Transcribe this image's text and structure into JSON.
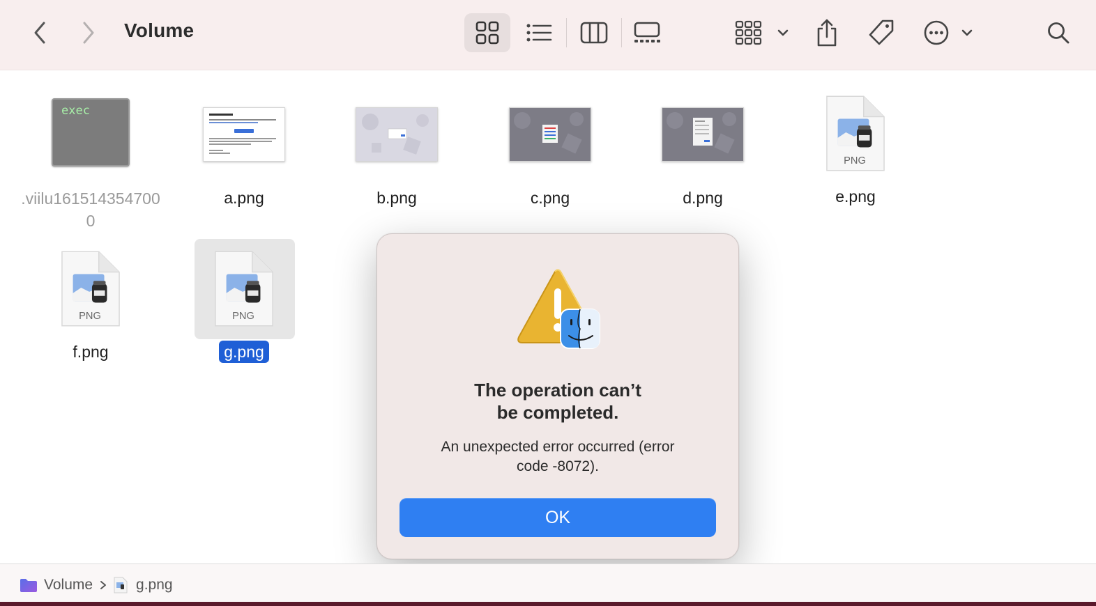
{
  "window": {
    "title": "Volume"
  },
  "toolbar": {
    "back": "back",
    "forward": "forward",
    "views": [
      "icon-view",
      "list-view",
      "column-view",
      "gallery-view"
    ],
    "group": "group-by",
    "share": "share",
    "tags": "tags",
    "more": "more-actions",
    "search": "search"
  },
  "files": [
    {
      "name": ".viilu1615143547000",
      "kind": "exec",
      "icon_text": "exec",
      "hidden": true
    },
    {
      "name": "a.png",
      "kind": "screenshot-doc"
    },
    {
      "name": "b.png",
      "kind": "screenshot-light"
    },
    {
      "name": "c.png",
      "kind": "screenshot-gray"
    },
    {
      "name": "d.png",
      "kind": "screenshot-gray"
    },
    {
      "name": "e.png",
      "kind": "png",
      "icon_text": "PNG"
    },
    {
      "name": "f.png",
      "kind": "png",
      "icon_text": "PNG"
    },
    {
      "name": "g.png",
      "kind": "png",
      "icon_text": "PNG",
      "selected": true
    }
  ],
  "dialog": {
    "title_line1": "The operation can’t",
    "title_line2": "be completed.",
    "message_line1": "An unexpected error occurred (error",
    "message_line2": "code -8072).",
    "ok_label": "OK"
  },
  "pathbar": {
    "folder": "Volume",
    "file": "g.png"
  },
  "colors": {
    "accent": "#2f7ff2",
    "selection": "#1f5fd6",
    "toolbar_bg": "#f8eeee",
    "dialog_bg": "#f1e8e7"
  }
}
